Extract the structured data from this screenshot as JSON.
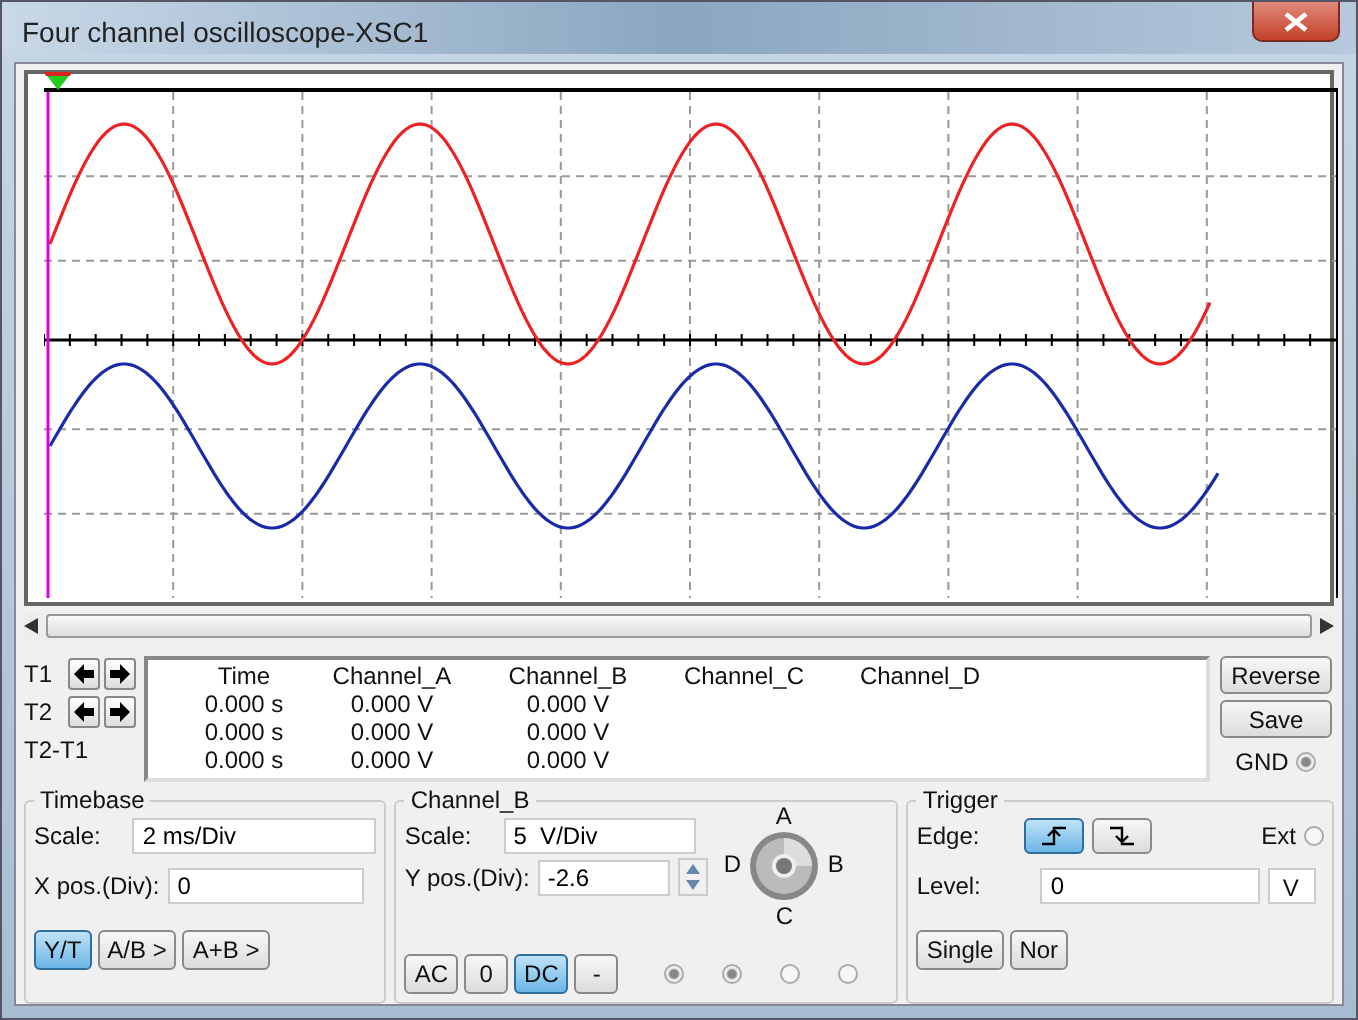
{
  "window": {
    "title": "Four channel oscilloscope-XSC1"
  },
  "cursors": [
    {
      "label": "T1"
    },
    {
      "label": "T2"
    },
    {
      "label": "T2-T1"
    }
  ],
  "readout": {
    "columns": [
      "Time",
      "Channel_A",
      "Channel_B",
      "Channel_C",
      "Channel_D"
    ],
    "rows": [
      [
        "0.000 s",
        "0.000 V",
        "0.000 V"
      ],
      [
        "0.000 s",
        "0.000 V",
        "0.000 V"
      ],
      [
        "0.000 s",
        "0.000 V",
        "0.000 V"
      ]
    ]
  },
  "side_buttons": [
    "Reverse",
    "Save"
  ],
  "gnd": {
    "label": "GND"
  },
  "timebase": {
    "title": "Timebase",
    "scale_label": "Scale:",
    "scale": "2 ms/Div",
    "xpos_label": "X pos.(Div):",
    "xpos": "0",
    "modes": [
      {
        "label": "Y/T",
        "selected": true
      },
      {
        "label": "A/B >",
        "selected": false
      },
      {
        "label": "A+B >",
        "selected": false
      }
    ]
  },
  "channel": {
    "title": "Channel_B",
    "scale_label": "Scale:",
    "scale": "5  V/Div",
    "ypos_label": "Y pos.(Div):",
    "ypos": "-2.6",
    "coupling": [
      {
        "label": "AC",
        "selected": false
      },
      {
        "label": "0",
        "selected": false
      },
      {
        "label": "DC",
        "selected": true
      },
      {
        "label": "-",
        "selected": false
      }
    ],
    "radios": [
      {
        "checked": true
      },
      {
        "checked": true
      },
      {
        "checked": false
      },
      {
        "checked": false
      }
    ],
    "knob": {
      "a": "A",
      "b": "B",
      "c": "C",
      "d": "D"
    }
  },
  "trigger": {
    "title": "Trigger",
    "edge_label": "Edge:",
    "edges": [
      {
        "kind": "rising",
        "selected": true
      },
      {
        "kind": "falling",
        "selected": false
      }
    ],
    "ext_label": "Ext",
    "level_label": "Level:",
    "level": "0",
    "unit": "V",
    "buttons": [
      "Single",
      "Nor"
    ]
  }
}
